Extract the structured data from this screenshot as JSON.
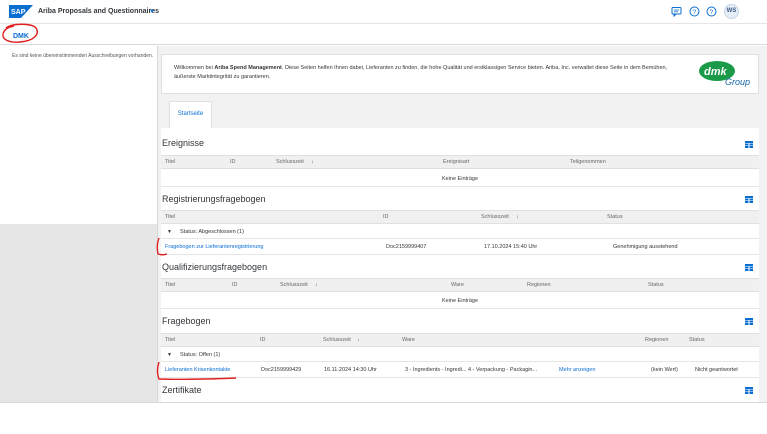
{
  "header": {
    "logo_text": "SAP",
    "app_title": "Ariba Proposals and Questionnaires",
    "avatar": "WS",
    "icons": [
      "chat-icon",
      "help-icon",
      "help-icon",
      "user-avatar"
    ]
  },
  "dmk": {
    "label": "DMK"
  },
  "left": {
    "message": "Es sind keine übereinstimmenden Ausschreibungen vorhanden."
  },
  "welcome": {
    "prefix": "Willkommen bei ",
    "bold": "Ariba Spend Management",
    "text": ". Diese Seiten helfen Ihnen dabei, Lieferanten zu finden, die hohe Qualität und erstklassigen Service bieten. Ariba, Inc. verwaltet diese Seite in dem Bemühen, äußerste Marktintegrität zu garantieren.",
    "logo_main": "dmk",
    "logo_sub": "Group"
  },
  "tabs": {
    "home": "Startseite"
  },
  "ereignisse": {
    "title": "Ereignisse",
    "columns": [
      "Titel",
      "ID",
      "Schlusszeit",
      "Ereignisart",
      "Teilgenommen"
    ],
    "empty": "Keine Einträge"
  },
  "registrierung": {
    "title": "Registrierungsfragebogen",
    "columns": [
      "Titel",
      "ID",
      "Schlusszeit",
      "Status"
    ],
    "group": "Status: Abgeschlossen  (1)",
    "row": {
      "title": "Fragebogen zur Lieferantenregistrierung",
      "id": "Doc2159999407",
      "time": "17.10.2024 15:40 Uhr",
      "status": "Genehmigung ausstehend"
    }
  },
  "qualifizierung": {
    "title": "Qualifizierungsfragebogen",
    "columns": [
      "Titel",
      "ID",
      "Schlusszeit",
      "Ware",
      "Regionen",
      "Status"
    ],
    "empty": "Keine Einträge"
  },
  "fragebogen": {
    "title": "Fragebogen",
    "columns": [
      "Titel",
      "ID",
      "Schlusszeit",
      "Ware",
      "Regionen",
      "Status"
    ],
    "group": "Status: Offen  (1)",
    "row": {
      "title": "Lieferanten Krisenkontakte",
      "id": "Doc2159999429",
      "time": "16.11.2024 14:30 Uhr",
      "ware": "3 - Ingredients - Ingredi... 4 - Verpackung - Packagin...",
      "more": "Mehr anzeigen",
      "region": "(kein Wert)",
      "status": "Nicht geantwortet"
    }
  },
  "zertifikate": {
    "title": "Zertifikate"
  },
  "colors": {
    "link": "#0a6ed1",
    "annotation": "#e02020"
  }
}
